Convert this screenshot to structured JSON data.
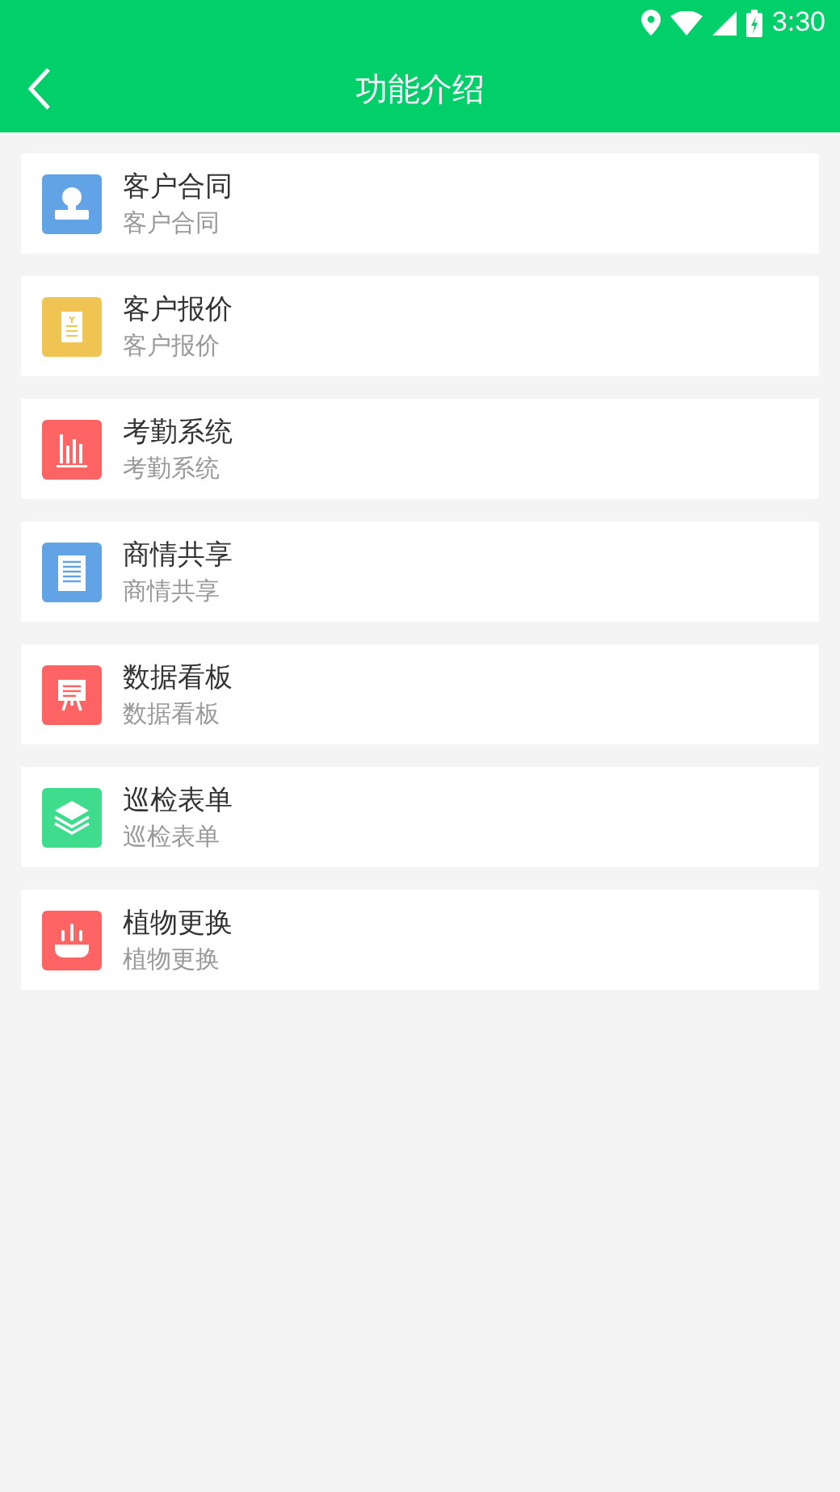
{
  "status_bar": {
    "time": "3:30"
  },
  "header": {
    "title": "功能介绍"
  },
  "items": [
    {
      "title": "客户合同",
      "subtitle": "客户合同",
      "kind": "stamp",
      "color": "#62a3e6"
    },
    {
      "title": "客户报价",
      "subtitle": "客户报价",
      "kind": "receipt",
      "color": "#efc453"
    },
    {
      "title": "考勤系统",
      "subtitle": "考勤系统",
      "kind": "chart",
      "color": "#fe6464"
    },
    {
      "title": "商情共享",
      "subtitle": "商情共享",
      "kind": "document",
      "color": "#62a3e6"
    },
    {
      "title": "数据看板",
      "subtitle": "数据看板",
      "kind": "board",
      "color": "#fe6464"
    },
    {
      "title": "巡检表单",
      "subtitle": "巡检表单",
      "kind": "layers",
      "color": "#3fdc8e"
    },
    {
      "title": "植物更换",
      "subtitle": "植物更换",
      "kind": "pot",
      "color": "#fe6464"
    }
  ]
}
